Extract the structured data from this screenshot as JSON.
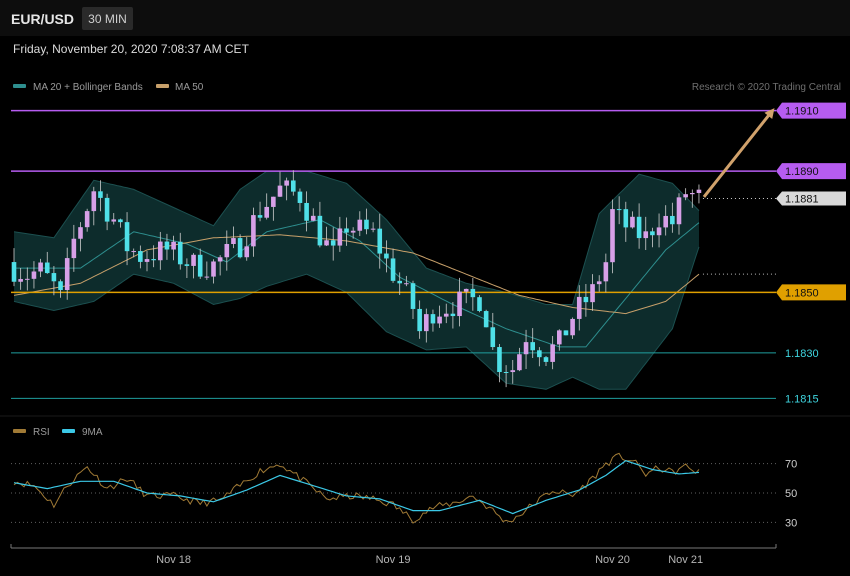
{
  "header": {
    "symbol": "EUR/USD",
    "interval": "30 MIN",
    "datetime": "Friday, November 20, 2020 7:08:37 AM CET",
    "copyright": "Research © 2020 Trading Central"
  },
  "colors": {
    "resistance": "#b65cf0",
    "support": "#e0a000",
    "target_line": "#1f9e9e",
    "bull_candle": "#d7a0e8",
    "bear_candle": "#4fe0e8",
    "bollinger_fill": "#0f3434",
    "ma20": "#2e8f8f",
    "ma50": "#c7a06a",
    "rsi": "#a07a35",
    "rsi_ma": "#3bc8e6",
    "arrow": "#d1a26c"
  },
  "chart_data": [
    {
      "type": "candlestick",
      "pair": "EUR/USD",
      "interval": "30 MIN",
      "ylim": [
        1.18105,
        1.19135
      ],
      "legend": [
        {
          "name": "MA 20 + Bollinger Bands",
          "color": "#2e8f8f"
        },
        {
          "name": "MA 50",
          "color": "#c7a06a"
        }
      ],
      "levels": [
        {
          "value": 1.191,
          "label": "1.1910",
          "kind": "resistance"
        },
        {
          "value": 1.189,
          "label": "1.1890",
          "kind": "resistance"
        },
        {
          "value": 1.1881,
          "label": "1.1881",
          "kind": "last"
        },
        {
          "value": 1.185,
          "label": "1.1850",
          "kind": "support"
        },
        {
          "value": 1.183,
          "label": "1.1830",
          "kind": "target"
        },
        {
          "value": 1.1815,
          "label": "1.1815",
          "kind": "target"
        }
      ],
      "x_ticks": [
        {
          "index": 24,
          "label": "Nov 18"
        },
        {
          "index": 57,
          "label": "Nov 19"
        },
        {
          "index": 90,
          "label": "Nov 20"
        },
        {
          "index": 101,
          "label": "Nov 21"
        }
      ],
      "last_index": 103,
      "close_anchors": [
        [
          0,
          1.1858
        ],
        [
          2,
          1.1856
        ],
        [
          4,
          1.1857
        ],
        [
          6,
          1.1852
        ],
        [
          7,
          1.1848
        ],
        [
          9,
          1.1867
        ],
        [
          12,
          1.1884
        ],
        [
          15,
          1.1874
        ],
        [
          17,
          1.1865
        ],
        [
          19,
          1.1862
        ],
        [
          23,
          1.1864
        ],
        [
          27,
          1.1859
        ],
        [
          30,
          1.1859
        ],
        [
          34,
          1.1866
        ],
        [
          37,
          1.1877
        ],
        [
          40,
          1.1884
        ],
        [
          43,
          1.1882
        ],
        [
          46,
          1.1869
        ],
        [
          48,
          1.1862
        ],
        [
          50,
          1.1872
        ],
        [
          54,
          1.1869
        ],
        [
          56,
          1.186
        ],
        [
          58,
          1.1853
        ],
        [
          60,
          1.1845
        ],
        [
          61,
          1.1837
        ],
        [
          63,
          1.1844
        ],
        [
          66,
          1.1846
        ],
        [
          70,
          1.1848
        ],
        [
          71,
          1.1842
        ],
        [
          72,
          1.1831
        ],
        [
          73,
          1.1827
        ],
        [
          75,
          1.1825
        ],
        [
          77,
          1.1836
        ],
        [
          80,
          1.183
        ],
        [
          82,
          1.1833
        ],
        [
          84,
          1.1842
        ],
        [
          87,
          1.185
        ],
        [
          89,
          1.186
        ],
        [
          90,
          1.1876
        ],
        [
          92,
          1.1872
        ],
        [
          95,
          1.1868
        ],
        [
          97,
          1.1875
        ],
        [
          99,
          1.1873
        ],
        [
          101,
          1.1883
        ],
        [
          103,
          1.1881
        ]
      ],
      "bollinger": {
        "upper": [
          [
            0,
            1.187
          ],
          [
            6,
            1.1868
          ],
          [
            12,
            1.1887
          ],
          [
            18,
            1.1884
          ],
          [
            24,
            1.1878
          ],
          [
            30,
            1.1872
          ],
          [
            34,
            1.1884
          ],
          [
            38,
            1.189
          ],
          [
            44,
            1.189
          ],
          [
            50,
            1.1886
          ],
          [
            56,
            1.1874
          ],
          [
            62,
            1.1858
          ],
          [
            68,
            1.1853
          ],
          [
            74,
            1.185
          ],
          [
            80,
            1.1846
          ],
          [
            84,
            1.1846
          ],
          [
            88,
            1.1876
          ],
          [
            94,
            1.1889
          ],
          [
            99,
            1.1886
          ],
          [
            103,
            1.1877
          ]
        ],
        "lower": [
          [
            0,
            1.1847
          ],
          [
            6,
            1.1844
          ],
          [
            12,
            1.1847
          ],
          [
            18,
            1.1856
          ],
          [
            24,
            1.1853
          ],
          [
            30,
            1.1846
          ],
          [
            34,
            1.1848
          ],
          [
            38,
            1.1852
          ],
          [
            44,
            1.1856
          ],
          [
            50,
            1.185
          ],
          [
            56,
            1.1837
          ],
          [
            62,
            1.1831
          ],
          [
            68,
            1.1832
          ],
          [
            74,
            1.182
          ],
          [
            80,
            1.1818
          ],
          [
            84,
            1.1822
          ],
          [
            88,
            1.1818
          ],
          [
            92,
            1.1818
          ],
          [
            99,
            1.1838
          ],
          [
            103,
            1.1865
          ]
        ]
      },
      "ma20": [
        [
          0,
          1.1858
        ],
        [
          10,
          1.1858
        ],
        [
          18,
          1.187
        ],
        [
          26,
          1.1866
        ],
        [
          32,
          1.186
        ],
        [
          38,
          1.187
        ],
        [
          46,
          1.1874
        ],
        [
          52,
          1.1867
        ],
        [
          58,
          1.1855
        ],
        [
          66,
          1.1846
        ],
        [
          74,
          1.1838
        ],
        [
          82,
          1.1832
        ],
        [
          86,
          1.1832
        ],
        [
          92,
          1.1848
        ],
        [
          98,
          1.1864
        ],
        [
          103,
          1.1873
        ]
      ],
      "ma50": [
        [
          0,
          1.1849
        ],
        [
          10,
          1.1853
        ],
        [
          20,
          1.1864
        ],
        [
          30,
          1.1868
        ],
        [
          40,
          1.1869
        ],
        [
          50,
          1.1867
        ],
        [
          60,
          1.1863
        ],
        [
          68,
          1.1856
        ],
        [
          76,
          1.1849
        ],
        [
          84,
          1.1845
        ],
        [
          92,
          1.1843
        ],
        [
          98,
          1.1847
        ],
        [
          103,
          1.1856
        ]
      ]
    },
    {
      "type": "line",
      "name": "RSI",
      "legend": [
        {
          "name": "RSI",
          "color": "#a07a35"
        },
        {
          "name": "9MA",
          "color": "#3bc8e6"
        }
      ],
      "ylim": [
        18,
        82
      ],
      "gridlines": [
        70,
        50,
        30
      ],
      "tick_labels": [
        "70",
        "50",
        "30"
      ],
      "rsi": [
        [
          0,
          58
        ],
        [
          3,
          55
        ],
        [
          6,
          42
        ],
        [
          8,
          55
        ],
        [
          11,
          68
        ],
        [
          14,
          53
        ],
        [
          17,
          60
        ],
        [
          20,
          48
        ],
        [
          24,
          48
        ],
        [
          28,
          43
        ],
        [
          31,
          45
        ],
        [
          34,
          55
        ],
        [
          37,
          65
        ],
        [
          40,
          70
        ],
        [
          43,
          60
        ],
        [
          47,
          46
        ],
        [
          51,
          48
        ],
        [
          54,
          46
        ],
        [
          57,
          42
        ],
        [
          60,
          32
        ],
        [
          63,
          40
        ],
        [
          66,
          43
        ],
        [
          69,
          48
        ],
        [
          72,
          38
        ],
        [
          74,
          30
        ],
        [
          76,
          35
        ],
        [
          78,
          42
        ],
        [
          81,
          52
        ],
        [
          84,
          48
        ],
        [
          87,
          60
        ],
        [
          89,
          70
        ],
        [
          91,
          75
        ],
        [
          93,
          72
        ],
        [
          95,
          63
        ],
        [
          97,
          67
        ],
        [
          99,
          64
        ],
        [
          101,
          68
        ],
        [
          103,
          64
        ]
      ],
      "ma9": [
        [
          0,
          57
        ],
        [
          5,
          53
        ],
        [
          10,
          58
        ],
        [
          15,
          58
        ],
        [
          20,
          50
        ],
        [
          25,
          48
        ],
        [
          30,
          44
        ],
        [
          35,
          52
        ],
        [
          40,
          62
        ],
        [
          45,
          55
        ],
        [
          50,
          48
        ],
        [
          55,
          46
        ],
        [
          60,
          38
        ],
        [
          64,
          38
        ],
        [
          70,
          45
        ],
        [
          75,
          36
        ],
        [
          80,
          45
        ],
        [
          85,
          52
        ],
        [
          89,
          62
        ],
        [
          92,
          72
        ],
        [
          96,
          66
        ],
        [
          100,
          63
        ],
        [
          103,
          64
        ]
      ]
    }
  ]
}
